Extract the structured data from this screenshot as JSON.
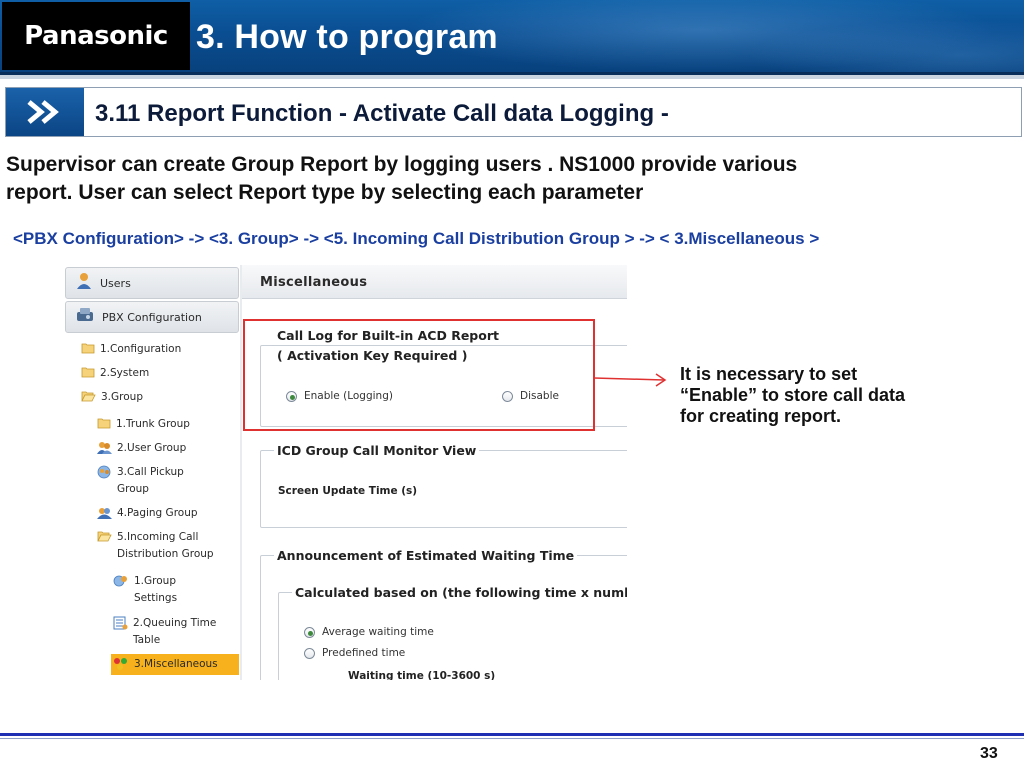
{
  "header": {
    "logo": "Panasonic",
    "title": "3. How to program"
  },
  "section": {
    "title": "3.11 Report Function  - Activate Call data Logging -"
  },
  "intro": {
    "line1": "Supervisor can create Group Report by logging users .  NS1000 provide various",
    "line2": "report.  User can select Report type by selecting each parameter"
  },
  "nav_path": "<PBX Configuration> -> <3. Group> -> <5. Incoming Call Distribution Group > -> < 3.Miscellaneous >",
  "screenshot": {
    "sidebar": {
      "users": "Users",
      "pbx_configuration": "PBX Configuration",
      "items": [
        {
          "label": "1.Configuration"
        },
        {
          "label": "2.System"
        },
        {
          "label": "3.Group"
        },
        {
          "label": "1.Trunk Group"
        },
        {
          "label": "2.User Group"
        },
        {
          "label1": "3.Call Pickup",
          "label2": "Group"
        },
        {
          "label": "4.Paging Group"
        },
        {
          "label1": "5.Incoming Call",
          "label2": "Distribution Group"
        },
        {
          "label1": "1.Group",
          "label2": "Settings"
        },
        {
          "label1": "2.Queuing Time",
          "label2": "Table"
        },
        {
          "label": "3.Miscellaneous"
        }
      ]
    },
    "panel": {
      "title": "Miscellaneous",
      "call_log": {
        "legend1": "Call Log for Built-in ACD Report",
        "legend2": "( Activation Key Required )",
        "enable": "Enable (Logging)",
        "disable": "Disable",
        "selected": "enable"
      },
      "icd_monitor": {
        "legend": "ICD Group Call Monitor View",
        "field": "Screen Update Time (s)"
      },
      "announcement": {
        "legend": "Announcement of Estimated Waiting Time",
        "sub_legend": "Calculated based on (the following time x numbe",
        "option1": "Average waiting time",
        "option2": "Predefined time",
        "selected": "option1",
        "field": "Waiting time (10-3600 s)"
      }
    }
  },
  "callout": {
    "line1": "It is necessary to set",
    "line2": "“Enable” to store call data",
    "line3": "for creating report."
  },
  "colors": {
    "header_blue": "#0a4e92",
    "highlight_red": "#e03131",
    "nav_path_blue": "#1a3fa0",
    "selected_orange": "#f7b11d"
  },
  "page_number": "33"
}
